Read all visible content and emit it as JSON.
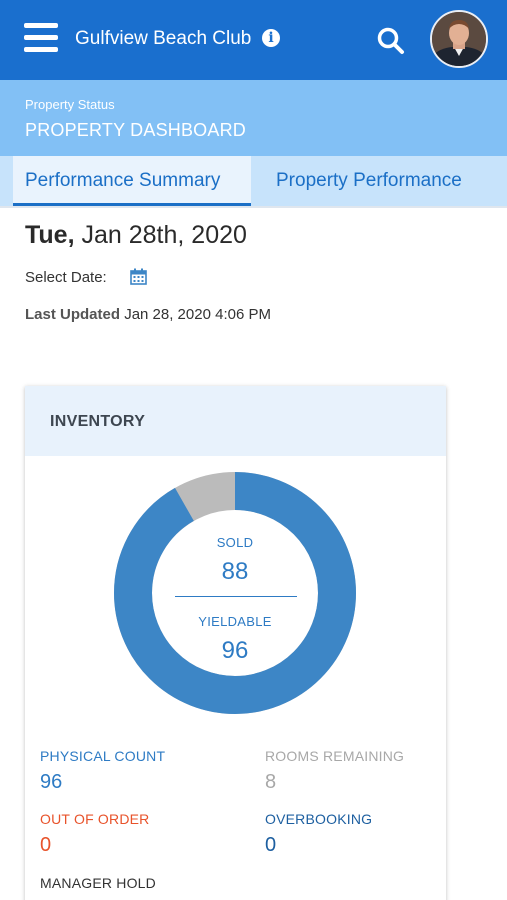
{
  "header": {
    "app_title": "Gulfview Beach Club",
    "info_icon": "info-icon",
    "search_icon": "search-icon",
    "menu_icon": "hamburger-menu-icon",
    "avatar": "user-avatar"
  },
  "banner": {
    "subtitle": "Property Status",
    "title": "PROPERTY DASHBOARD"
  },
  "tabs": [
    {
      "label": "Performance Summary",
      "active": true
    },
    {
      "label": "Property Performance",
      "active": false
    }
  ],
  "date": {
    "weekday": "Tue,",
    "date": "Jan 28th, 2020",
    "select_label": "Select Date:",
    "calendar_icon": "calendar-icon",
    "last_updated_label": "Last Updated",
    "last_updated_value": "Jan 28, 2020 4:06 PM"
  },
  "inventory": {
    "title": "INVENTORY",
    "sold_label": "SOLD",
    "sold_value": "88",
    "yieldable_label": "YIELDABLE",
    "yieldable_value": "96",
    "sold_fraction": 0.917,
    "colors": {
      "sold": "#3d86c6",
      "remaining": "#bbbbbb"
    },
    "stats": {
      "physical_count_label": "PHYSICAL COUNT",
      "physical_count_value": "96",
      "rooms_remaining_label": "ROOMS REMAINING",
      "rooms_remaining_value": "8",
      "out_of_order_label": "OUT OF ORDER",
      "out_of_order_value": "0",
      "overbooking_label": "OVERBOOKING",
      "overbooking_value": "0",
      "manager_hold_label": "MANAGER HOLD"
    }
  }
}
